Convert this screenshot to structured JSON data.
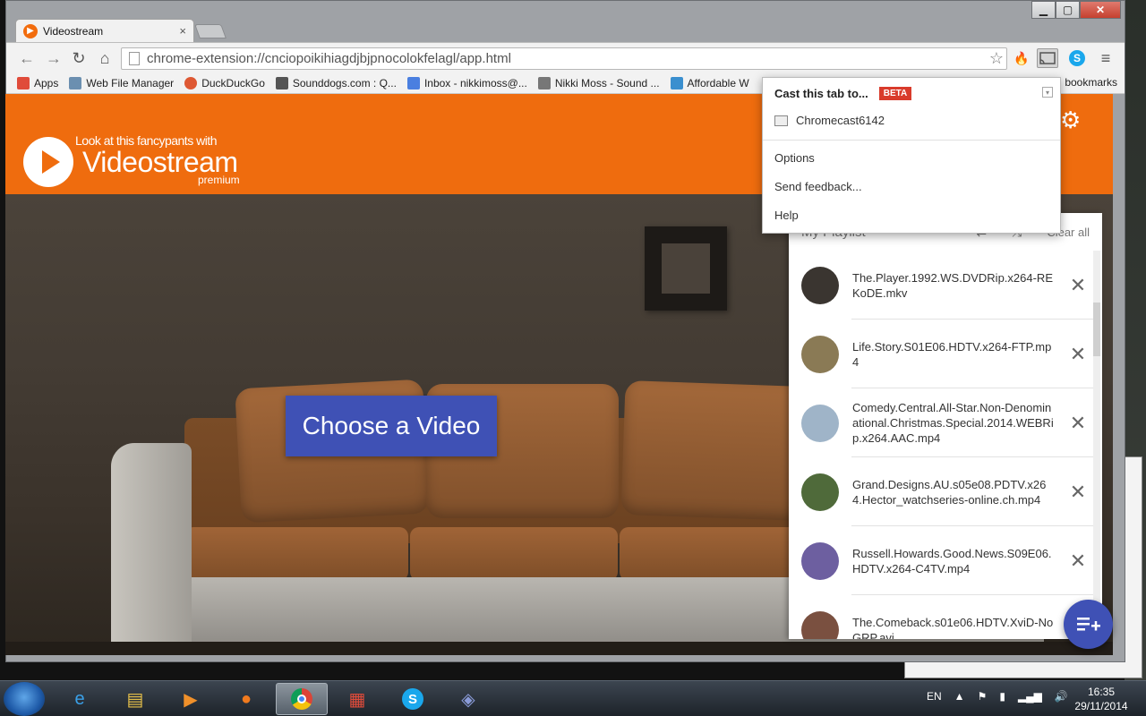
{
  "browser": {
    "tab_title": "Videostream",
    "tab_close": "×",
    "url": "chrome-extension://cnciopoikihiagdjbjpnocolokfelagl/app.html",
    "nav": {
      "back": "←",
      "forward": "→",
      "reload": "↻",
      "home": "⌂"
    },
    "star": "☆",
    "menu_icon": "≡"
  },
  "window_controls": {
    "minimize": "▁",
    "maximize": "▢",
    "close": "✕"
  },
  "bookmarks": [
    {
      "label": "Apps",
      "icon": "apps-grid-icon",
      "color": "#e04b3a"
    },
    {
      "label": "Web File Manager",
      "icon": "web-file-manager-icon",
      "color": "#6b8fb0"
    },
    {
      "label": "DuckDuckGo",
      "icon": "duckduckgo-icon",
      "color": "#de5833"
    },
    {
      "label": "Sounddogs.com : Q...",
      "icon": "sounddogs-icon",
      "color": "#555555"
    },
    {
      "label": "Inbox - nikkimoss@...",
      "icon": "google-icon",
      "color": "#4a7fe0"
    },
    {
      "label": "Nikki Moss - Sound ...",
      "icon": "soundcloud-icon",
      "color": "#777777"
    },
    {
      "label": "Affordable W",
      "icon": "affordable-icon",
      "color": "#3a8fcf"
    }
  ],
  "bookmarks_other": "bookmarks",
  "app": {
    "logo_tagline": "Look at this fancypants with",
    "logo_name": "Videostream",
    "logo_sub": "premium",
    "choose_button": "Choose a Video",
    "accent": "#ef6c0e",
    "primary": "#3f51b5"
  },
  "playlist": {
    "title": "My Playlist",
    "clear_all": "Clear all",
    "items": [
      {
        "name": "The.Player.1992.WS.DVDRip.x264-REKoDE.mkv",
        "thumb": "#3a3530"
      },
      {
        "name": "Life.Story.S01E06.HDTV.x264-FTP.mp4",
        "thumb": "#8a7a55"
      },
      {
        "name": "Comedy.Central.All-Star.Non-Denominational.Christmas.Special.2014.WEBRip.x264.AAC.mp4",
        "thumb": "#9fb4c8"
      },
      {
        "name": "Grand.Designs.AU.s05e08.PDTV.x264.Hector_watchseries-online.ch.mp4",
        "thumb": "#4f6a3a"
      },
      {
        "name": "Russell.Howards.Good.News.S09E06.HDTV.x264-C4TV.mp4",
        "thumb": "#6d5fa0"
      },
      {
        "name": "The.Comeback.s01e06.HDTV.XviD-NoGRP.avi",
        "thumb": "#7a5040"
      }
    ]
  },
  "cast_menu": {
    "title": "Cast this tab to...",
    "badge": "BETA",
    "device": "Chromecast6142",
    "options": "Options",
    "feedback": "Send feedback...",
    "help": "Help"
  },
  "taskbar": {
    "lang": "EN",
    "time": "16:35",
    "date": "29/11/2014"
  }
}
